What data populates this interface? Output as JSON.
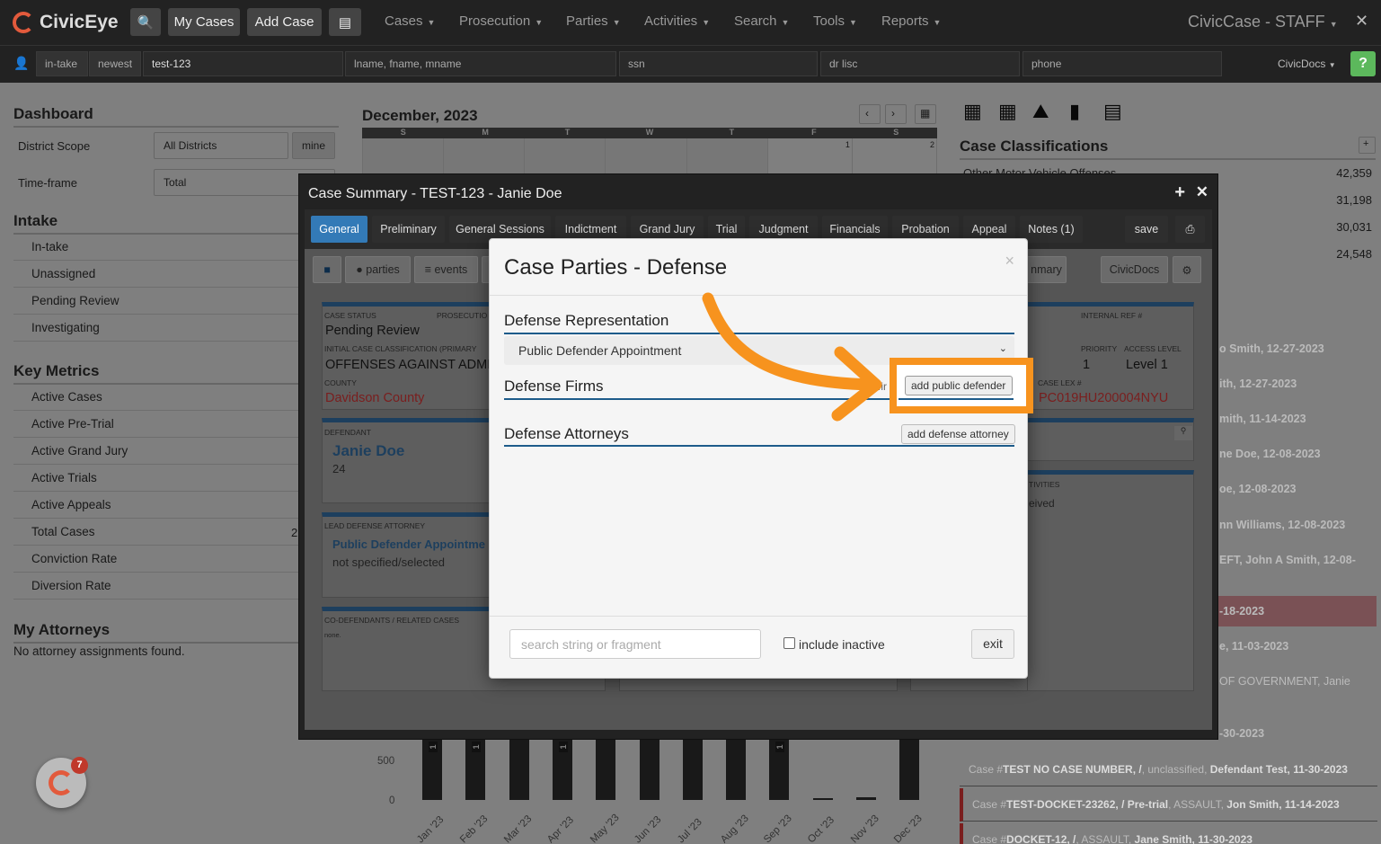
{
  "app": {
    "brand": "CivicEye",
    "title": "CivicCase - STAFF"
  },
  "topnav": {
    "my_cases": "My Cases",
    "add_case": "Add Case",
    "menus": [
      "Cases",
      "Prosecution",
      "Parties",
      "Activities",
      "Search",
      "Tools",
      "Reports"
    ]
  },
  "searchbar": {
    "intake": "in-take",
    "newest": "newest",
    "case_value": "test-123",
    "name_ph": "lname, fname, mname",
    "ssn_ph": "ssn",
    "dl_ph": "dr lisc",
    "phone_ph": "phone",
    "civicdocs": "CivicDocs",
    "help": "?"
  },
  "dashboard": {
    "title": "Dashboard",
    "district_scope_label": "District Scope",
    "district_scope_value": "All Districts",
    "mine": "mine",
    "timeframe_label": "Time-frame",
    "timeframe_value": "Total",
    "intake_title": "Intake",
    "intake_items": [
      "In-take",
      "Unassigned",
      "Pending Review",
      "Investigating"
    ],
    "metrics_title": "Key Metrics",
    "metrics_items": [
      "Active Cases",
      "Active Pre-Trial",
      "Active Grand Jury",
      "Active Trials",
      "Active Appeals",
      "Total Cases",
      "Conviction Rate",
      "Diversion Rate"
    ],
    "total_cases_partial": "2",
    "attorneys_title": "My Attorneys",
    "attorneys_empty": "No attorney assignments found."
  },
  "calendar": {
    "month": "December, 2023",
    "days": [
      "S",
      "M",
      "T",
      "W",
      "T",
      "F",
      "S"
    ],
    "date1": "1",
    "date2": "2"
  },
  "chart_data": {
    "type": "bar",
    "categories": [
      "Jan '23",
      "Feb '23",
      "Mar '23",
      "Apr '23",
      "May '23",
      "Jun '23",
      "Jul '23",
      "Aug '23",
      "Sep '23",
      "Oct '23",
      "Nov '23",
      "Dec '23"
    ],
    "yticks": [
      "500",
      "0"
    ],
    "values": [
      null,
      null,
      null,
      null,
      null,
      null,
      null,
      null,
      null,
      5,
      10,
      null
    ],
    "bar_labels": [
      "1",
      "1",
      "",
      "1",
      "",
      "",
      "",
      "",
      "1",
      "",
      "",
      ""
    ]
  },
  "classifications": {
    "title": "Case Classifications",
    "add": "+",
    "first_label": "Other Motor Vehicle Offenses",
    "counts": [
      "42,359",
      "31,198",
      "30,031",
      "24,548"
    ]
  },
  "recent": {
    "partials": [
      "o Smith, 12-27-2023",
      "ith, 12-27-2023",
      "mith, 11-14-2023",
      "ne Doe, 12-08-2023",
      "oe, 12-08-2023",
      "nn Williams, 12-08-2023",
      "EFT, John A Smith, 12-08-",
      "-18-2023",
      "e, 11-03-2023",
      "OF GOVERNMENT, Janie",
      "-30-2023"
    ],
    "cases": [
      {
        "prefix": "Case #",
        "num": "TEST NO CASE NUMBER, /",
        "mid": ", unclassified, ",
        "party": "Defendant Test, 11-30-2023"
      },
      {
        "prefix": "Case #",
        "num": "TEST-DOCKET-23262, / Pre-trial",
        "mid": ", ASSAULT, ",
        "party": "Jon Smith, 11-14-2023"
      },
      {
        "prefix": "Case #",
        "num": "DOCKET-12, /",
        "mid": ", ASSAULT, ",
        "party": "Jane Smith, 11-30-2023"
      }
    ]
  },
  "case_summary": {
    "title": "Case Summary - TEST-123 - Janie Doe",
    "tabs": [
      "General",
      "Preliminary",
      "General Sessions",
      "Indictment",
      "Grand Jury",
      "Trial",
      "Judgment",
      "Financials",
      "Probation",
      "Appeal",
      "Notes (1)"
    ],
    "save": "save",
    "parties": "parties",
    "events": "events",
    "summary_partial": "nmary",
    "civicdocs": "CivicDocs",
    "case_status_label": "CASE STATUS",
    "case_status": "Pending Review",
    "prosecution_label": "PROSECUTIO",
    "initial_class_label": "INITIAL CASE CLASSIFICATION (PRIMARY",
    "initial_class": "OFFENSES AGAINST ADMI",
    "county_label": "COUNTY",
    "county": "Davidson County",
    "internal_ref_label": "INTERNAL REF #",
    "priority_label": "PRIORITY",
    "priority": "1",
    "access_label": "ACCESS LEVEL",
    "access": "Level 1",
    "case_lex_label": "CASE LEX #",
    "case_lex": "PC019HU200004NYU",
    "defendant_label": "DEFENDANT",
    "defendant": "Janie Doe",
    "defendant_age": "24",
    "lead_label": "LEAD DEFENSE ATTORNEY",
    "lead": "Public Defender Appointme",
    "lead_sub": "not specified/selected",
    "codef_label": "CO-DEFENDANTS / RELATED CASES",
    "codef": "none.",
    "activities_label": "TIVITIES",
    "activities_val": "eived"
  },
  "modal": {
    "title": "Case Parties - Defense",
    "rep_title": "Defense Representation",
    "rep_value": "Public Defender Appointment",
    "firms_title": "Defense Firms",
    "firms_partial": "fir",
    "add_pd": "add public defender",
    "attorneys_title": "Defense Attorneys",
    "add_att": "add defense attorney",
    "search_ph": "search string or fragment",
    "include_inactive": "include inactive",
    "exit": "exit",
    "close": "×"
  },
  "chat": {
    "badge": "7"
  },
  "colors": {
    "accent": "#337ab7",
    "highlight": "#f7931e",
    "brand": "#e25a3c"
  }
}
